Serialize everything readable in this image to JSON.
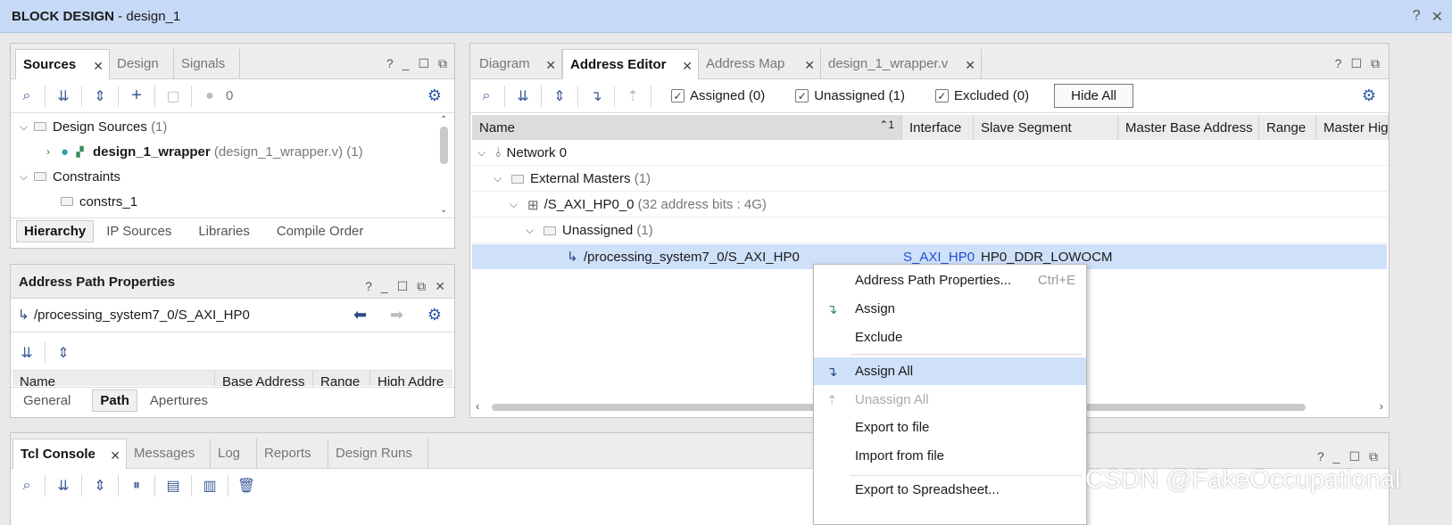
{
  "window": {
    "title_bold": "BLOCK DESIGN",
    "title_rest": " - design_1",
    "help": "?",
    "close": "✕"
  },
  "sources": {
    "tabs": [
      "Sources",
      "Design",
      "Signals"
    ],
    "status_count": "0",
    "tree": [
      {
        "label": "Design Sources",
        "suffix": "(1)"
      },
      {
        "label": "design_1_wrapper",
        "suffix": "(design_1_wrapper.v) (1)"
      },
      {
        "label": "Constraints",
        "suffix": ""
      },
      {
        "label": "constrs_1",
        "suffix": ""
      }
    ],
    "bottom_tabs": [
      "Hierarchy",
      "IP Sources",
      "Libraries",
      "Compile Order"
    ]
  },
  "props": {
    "title": "Address Path Properties",
    "path": "/processing_system7_0/S_AXI_HP0",
    "columns": [
      "Name",
      "Base Address",
      "Range",
      "High Addre"
    ],
    "bottom_tabs": [
      "General",
      "Path",
      "Apertures"
    ]
  },
  "editor": {
    "tabs": [
      "Diagram",
      "Address Editor",
      "Address Map",
      "design_1_wrapper.v"
    ],
    "filters": {
      "assigned": "Assigned (0)",
      "unassigned": "Unassigned (1)",
      "excluded": "Excluded (0)"
    },
    "hide_all": "Hide All",
    "columns": [
      "Name",
      "Interface",
      "Slave Segment",
      "Master Base Address",
      "Range",
      "Master Hig"
    ],
    "sort_indicator": "1",
    "rows": [
      {
        "label": "Network 0",
        "suffix": ""
      },
      {
        "label": "External Masters",
        "suffix": "(1)"
      },
      {
        "label": "/S_AXI_HP0_0",
        "suffix": "(32 address bits : 4G)"
      },
      {
        "label": "Unassigned",
        "suffix": "(1)"
      },
      {
        "label": "/processing_system7_0/S_AXI_HP0",
        "interface": "S_AXI_HP0",
        "segment": "HP0_DDR_LOWOCM"
      }
    ]
  },
  "context_menu": {
    "items": [
      {
        "label": "Address Path Properties...",
        "shortcut": "Ctrl+E"
      },
      {
        "label": "Assign"
      },
      {
        "label": "Exclude"
      },
      {
        "label": "Assign All"
      },
      {
        "label": "Unassign All"
      },
      {
        "label": "Export to file"
      },
      {
        "label": "Import from file"
      },
      {
        "label": "Export to Spreadsheet..."
      }
    ]
  },
  "console": {
    "tabs": [
      "Tcl Console",
      "Messages",
      "Log",
      "Reports",
      "Design Runs"
    ]
  },
  "watermark": "CSDN @FakeOccupational",
  "colors": {
    "titlebar": "#c6d9f6",
    "selection": "#cfe0f9",
    "link": "#1f4fd6",
    "accent": "#2e5aa8"
  }
}
